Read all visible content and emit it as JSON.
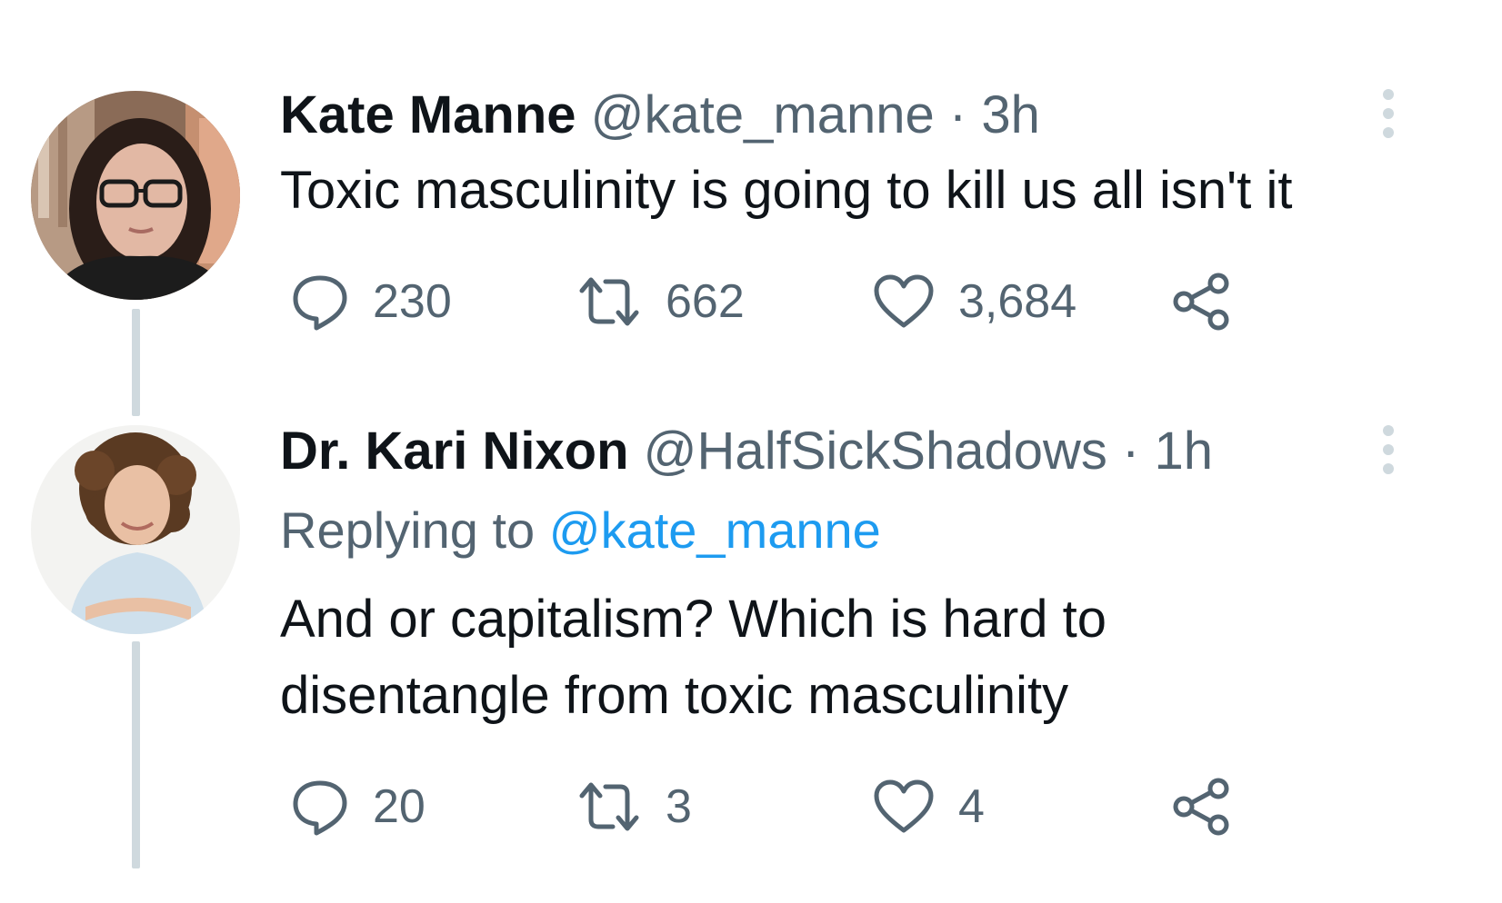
{
  "tweets": [
    {
      "display_name": "Kate Manne",
      "handle": "@kate_manne",
      "separator": "·",
      "time": "3h",
      "text_lines": [
        "Toxic masculinity is going to kill us all isn't it"
      ],
      "counts": {
        "replies": "230",
        "retweets": "662",
        "likes": "3,684"
      },
      "avatar": "woman-with-glasses-avatar"
    },
    {
      "display_name": "Dr. Kari Nixon",
      "handle": "@HalfSickShadows",
      "separator": "·",
      "time": "1h",
      "replying_prefix": "Replying to",
      "replying_to": "@kate_manne",
      "text_lines": [
        "And or capitalism? Which is hard to",
        "disentangle from toxic masculinity"
      ],
      "counts": {
        "replies": "20",
        "retweets": "3",
        "likes": "4"
      },
      "avatar": "woman-curly-hair-avatar"
    }
  ],
  "icons": {
    "reply": "reply-bubble-icon",
    "retweet": "retweet-icon",
    "like": "heart-icon",
    "share": "share-icon",
    "more": "more-vertical-icon"
  },
  "colors": {
    "text": "#0f1419",
    "secondary": "#536471",
    "link": "#1d9bf0",
    "thread_line": "#cfd9de"
  }
}
